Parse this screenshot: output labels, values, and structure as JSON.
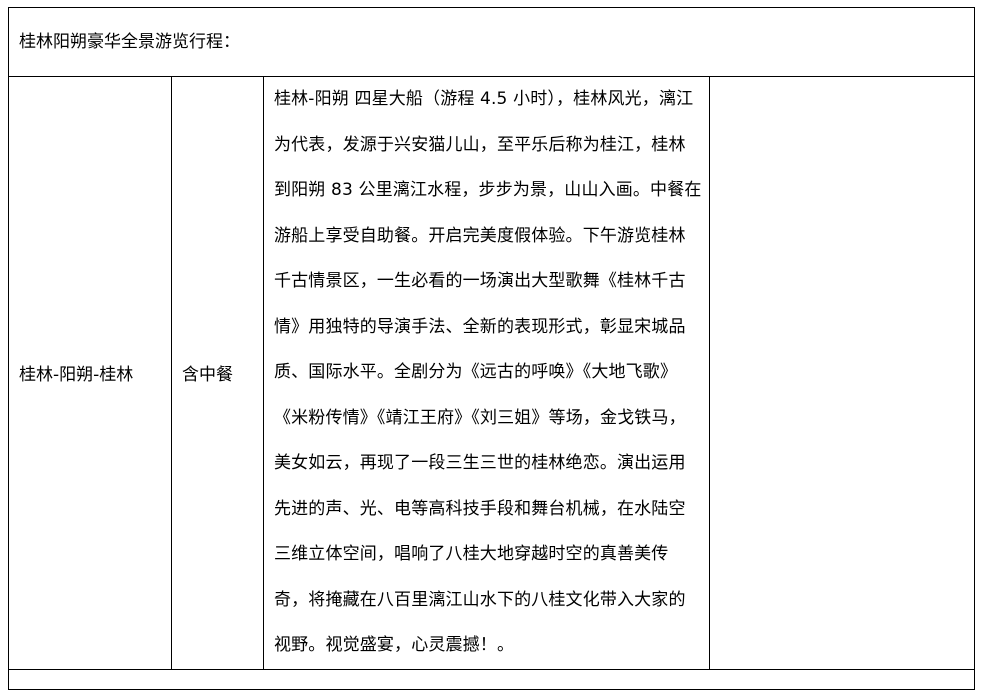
{
  "header": {
    "title": "桂林阳朔豪华全景游览行程："
  },
  "itinerary": {
    "route": "桂林-阳朔-桂林",
    "meal": "含中餐",
    "description": "桂林-阳朔 四星大船（游程 4.5 小时），桂林风光，漓江为代表，发源于兴安猫儿山，至平乐后称为桂江，桂林到阳朔 83 公里漓江水程，步步为景，山山入画。中餐在游船上享受自助餐。开启完美度假体验。下午游览桂林千古情景区，一生必看的一场演出大型歌舞《桂林千古情》用独特的导演手法、全新的表现形式，彰显宋城品质、国际水平。全剧分为《远古的呼唤》《大地飞歌》《米粉传情》《靖江王府》《刘三姐》等场，金戈铁马，美女如云，再现了一段三生三世的桂林绝恋。演出运用先进的声、光、电等高科技手段和舞台机械，在水陆空三维立体空间，唱响了八桂大地穿越时空的真善美传奇，将掩藏在八百里漓江山水下的八桂文化带入大家的视野。视觉盛宴，心灵震撼！。",
    "notes": ""
  }
}
